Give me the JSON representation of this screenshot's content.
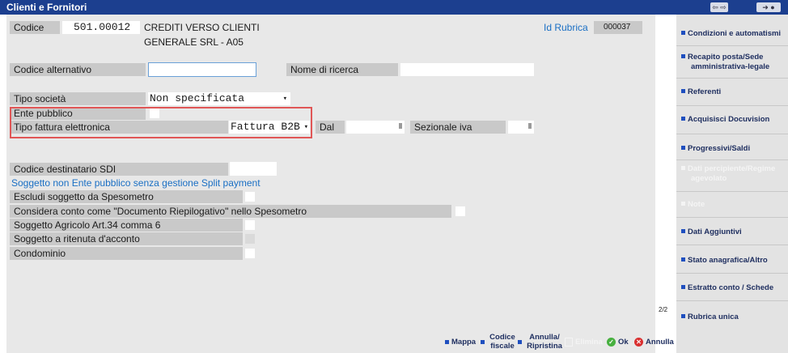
{
  "window": {
    "title": "Clienti e Fornitori",
    "nav_label": "⇦ ⇨",
    "pin_label": "➜ ●"
  },
  "header": {
    "code_label": "Codice",
    "code_value": "501.00012",
    "name_line1": "CREDITI VERSO CLIENTI",
    "name_line2": "GENERALE SRL - A05",
    "rubrica_label": "Id Rubrica",
    "rubrica_value": "000037"
  },
  "fields": {
    "codice_alternativo": "Codice alternativo",
    "nome_ricerca": "Nome di ricerca",
    "tipo_societa": "Tipo società",
    "tipo_societa_value": "Non specificata",
    "ente_pubblico": "Ente pubblico",
    "tipo_fattura": "Tipo fattura elettronica",
    "tipo_fattura_value": "Fattura B2B",
    "dal": "Dal",
    "sezionale_iva": "Sezionale iva",
    "codice_sdi": "Codice destinatario SDI",
    "split_payment_info": "Soggetto non Ente pubblico senza gestione Split payment",
    "escludi_spesometro": "Escludi soggetto da Spesometro",
    "documento_riepilogativo": "Considera conto come \"Documento Riepilogativo\" nello Spesometro",
    "soggetto_agricolo": "Soggetto Agricolo Art.34 comma 6",
    "ritenuta_acconto": "Soggetto a ritenuta d'acconto",
    "condominio": "Condominio"
  },
  "scroll": {
    "page": "2/2"
  },
  "side_menu": [
    {
      "label": "Condizioni e automatismi",
      "enabled": true
    },
    {
      "label": "Recapito posta/Sede amministrativa-legale",
      "enabled": true
    },
    {
      "label": "Referenti",
      "enabled": true
    },
    {
      "label": "Acquisisci Docuvision",
      "enabled": true
    },
    {
      "label": "Progressivi/Saldi",
      "enabled": true
    },
    {
      "label": "Dati percipiente/Regime agevolato",
      "enabled": false
    },
    {
      "label": "Note",
      "enabled": false
    },
    {
      "label": "Dati Aggiuntivi",
      "enabled": true
    },
    {
      "label": "Stato anagrafica/Altro",
      "enabled": true
    },
    {
      "label": "Estratto conto / Schede",
      "enabled": true
    },
    {
      "label": "Rubrica unica",
      "enabled": true
    }
  ],
  "bottom": {
    "mappa": "Mappa",
    "codice_fiscale": "Codice fiscale",
    "annulla_ripristina": "Annulla/ Ripristina",
    "elimina": "Elimina",
    "ok": "Ok",
    "annulla": "Annulla"
  },
  "colors": {
    "titlebar": "#1c3f8f",
    "panel": "#e8e8e8",
    "label_bg": "#c9c9c9",
    "link_blue": "#1a6fc4",
    "highlight_red": "#e05656"
  }
}
